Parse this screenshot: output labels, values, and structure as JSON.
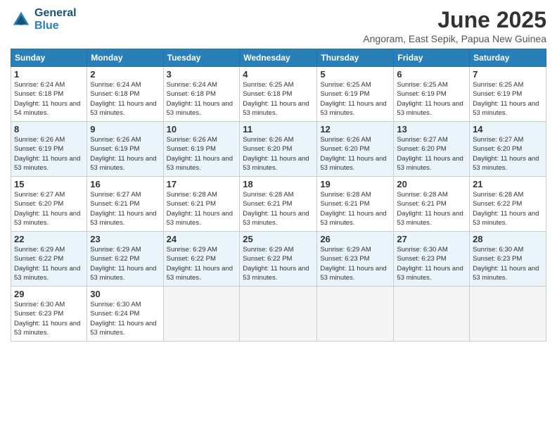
{
  "logo": {
    "line1": "General",
    "line2": "Blue"
  },
  "title": "June 2025",
  "subtitle": "Angoram, East Sepik, Papua New Guinea",
  "weekdays": [
    "Sunday",
    "Monday",
    "Tuesday",
    "Wednesday",
    "Thursday",
    "Friday",
    "Saturday"
  ],
  "weeks": [
    [
      {
        "day": 1,
        "sunrise": "6:24 AM",
        "sunset": "6:18 PM",
        "daylight": "11 hours and 54 minutes."
      },
      {
        "day": 2,
        "sunrise": "6:24 AM",
        "sunset": "6:18 PM",
        "daylight": "11 hours and 53 minutes."
      },
      {
        "day": 3,
        "sunrise": "6:24 AM",
        "sunset": "6:18 PM",
        "daylight": "11 hours and 53 minutes."
      },
      {
        "day": 4,
        "sunrise": "6:25 AM",
        "sunset": "6:18 PM",
        "daylight": "11 hours and 53 minutes."
      },
      {
        "day": 5,
        "sunrise": "6:25 AM",
        "sunset": "6:19 PM",
        "daylight": "11 hours and 53 minutes."
      },
      {
        "day": 6,
        "sunrise": "6:25 AM",
        "sunset": "6:19 PM",
        "daylight": "11 hours and 53 minutes."
      },
      {
        "day": 7,
        "sunrise": "6:25 AM",
        "sunset": "6:19 PM",
        "daylight": "11 hours and 53 minutes."
      }
    ],
    [
      {
        "day": 8,
        "sunrise": "6:26 AM",
        "sunset": "6:19 PM",
        "daylight": "11 hours and 53 minutes."
      },
      {
        "day": 9,
        "sunrise": "6:26 AM",
        "sunset": "6:19 PM",
        "daylight": "11 hours and 53 minutes."
      },
      {
        "day": 10,
        "sunrise": "6:26 AM",
        "sunset": "6:19 PM",
        "daylight": "11 hours and 53 minutes."
      },
      {
        "day": 11,
        "sunrise": "6:26 AM",
        "sunset": "6:20 PM",
        "daylight": "11 hours and 53 minutes."
      },
      {
        "day": 12,
        "sunrise": "6:26 AM",
        "sunset": "6:20 PM",
        "daylight": "11 hours and 53 minutes."
      },
      {
        "day": 13,
        "sunrise": "6:27 AM",
        "sunset": "6:20 PM",
        "daylight": "11 hours and 53 minutes."
      },
      {
        "day": 14,
        "sunrise": "6:27 AM",
        "sunset": "6:20 PM",
        "daylight": "11 hours and 53 minutes."
      }
    ],
    [
      {
        "day": 15,
        "sunrise": "6:27 AM",
        "sunset": "6:20 PM",
        "daylight": "11 hours and 53 minutes."
      },
      {
        "day": 16,
        "sunrise": "6:27 AM",
        "sunset": "6:21 PM",
        "daylight": "11 hours and 53 minutes."
      },
      {
        "day": 17,
        "sunrise": "6:28 AM",
        "sunset": "6:21 PM",
        "daylight": "11 hours and 53 minutes."
      },
      {
        "day": 18,
        "sunrise": "6:28 AM",
        "sunset": "6:21 PM",
        "daylight": "11 hours and 53 minutes."
      },
      {
        "day": 19,
        "sunrise": "6:28 AM",
        "sunset": "6:21 PM",
        "daylight": "11 hours and 53 minutes."
      },
      {
        "day": 20,
        "sunrise": "6:28 AM",
        "sunset": "6:21 PM",
        "daylight": "11 hours and 53 minutes."
      },
      {
        "day": 21,
        "sunrise": "6:28 AM",
        "sunset": "6:22 PM",
        "daylight": "11 hours and 53 minutes."
      }
    ],
    [
      {
        "day": 22,
        "sunrise": "6:29 AM",
        "sunset": "6:22 PM",
        "daylight": "11 hours and 53 minutes."
      },
      {
        "day": 23,
        "sunrise": "6:29 AM",
        "sunset": "6:22 PM",
        "daylight": "11 hours and 53 minutes."
      },
      {
        "day": 24,
        "sunrise": "6:29 AM",
        "sunset": "6:22 PM",
        "daylight": "11 hours and 53 minutes."
      },
      {
        "day": 25,
        "sunrise": "6:29 AM",
        "sunset": "6:22 PM",
        "daylight": "11 hours and 53 minutes."
      },
      {
        "day": 26,
        "sunrise": "6:29 AM",
        "sunset": "6:23 PM",
        "daylight": "11 hours and 53 minutes."
      },
      {
        "day": 27,
        "sunrise": "6:30 AM",
        "sunset": "6:23 PM",
        "daylight": "11 hours and 53 minutes."
      },
      {
        "day": 28,
        "sunrise": "6:30 AM",
        "sunset": "6:23 PM",
        "daylight": "11 hours and 53 minutes."
      }
    ],
    [
      {
        "day": 29,
        "sunrise": "6:30 AM",
        "sunset": "6:23 PM",
        "daylight": "11 hours and 53 minutes."
      },
      {
        "day": 30,
        "sunrise": "6:30 AM",
        "sunset": "6:24 PM",
        "daylight": "11 hours and 53 minutes."
      },
      null,
      null,
      null,
      null,
      null
    ]
  ]
}
